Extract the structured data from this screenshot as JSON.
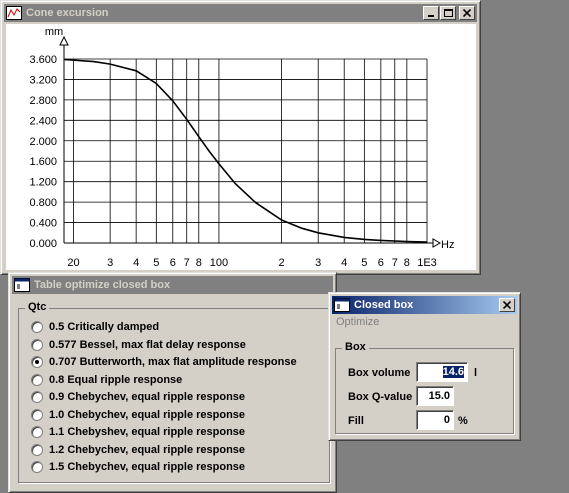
{
  "cone_window": {
    "title": "Cone excursion",
    "chart": {
      "y_unit": "mm",
      "x_unit": "Hz"
    }
  },
  "chart_data": {
    "type": "line",
    "title": "Cone excursion",
    "ylabel": "mm",
    "xlabel": "Hz",
    "x_scale": "log",
    "xlim": [
      18,
      1000
    ],
    "ylim": [
      0,
      3.6
    ],
    "grid": true,
    "y_ticks": [
      "3.600",
      "3.200",
      "2.800",
      "2.400",
      "2.000",
      "1.600",
      "1.200",
      "0.800",
      "0.400",
      "0.000"
    ],
    "x_ticks": [
      "20",
      "3",
      "4",
      "5",
      "6",
      "7",
      "8",
      "100",
      "2",
      "3",
      "4",
      "5",
      "6",
      "7",
      "8",
      "1E3"
    ],
    "x": [
      18,
      25,
      30,
      40,
      50,
      60,
      70,
      80,
      90,
      100,
      120,
      150,
      200,
      250,
      300,
      400,
      500,
      600,
      800,
      1000
    ],
    "y": [
      3.59,
      3.55,
      3.5,
      3.37,
      3.12,
      2.78,
      2.42,
      2.08,
      1.79,
      1.55,
      1.16,
      0.79,
      0.45,
      0.29,
      0.2,
      0.11,
      0.07,
      0.05,
      0.03,
      0.02
    ]
  },
  "table_window": {
    "title": "Table optimize closed box",
    "group_label": "Qtc",
    "options": [
      {
        "label": "0.5 Critically damped",
        "selected": false
      },
      {
        "label": "0.577 Bessel, max flat delay response",
        "selected": false
      },
      {
        "label": "0.707 Butterworth, max flat amplitude response",
        "selected": true
      },
      {
        "label": "0.8 Equal ripple response",
        "selected": false
      },
      {
        "label": "0.9 Chebychev, equal ripple response",
        "selected": false
      },
      {
        "label": "1.0 Chebychev, equal ripple response",
        "selected": false
      },
      {
        "label": "1.1 Chebyshev, equal ripple response",
        "selected": false
      },
      {
        "label": "1.2 Chebychev, equal ripple response",
        "selected": false
      },
      {
        "label": "1.5 Chebychev, equal ripple response",
        "selected": false
      }
    ]
  },
  "closed_box_window": {
    "title": "Closed box",
    "menu_optimize": "Optimize",
    "group_label": "Box",
    "box_volume_label": "Box volume",
    "box_volume_value": "14.6",
    "box_volume_unit": "l",
    "box_q_label": "Box Q-value",
    "box_q_value": "15.0",
    "fill_label": "Fill",
    "fill_value": "0",
    "fill_unit": "%"
  },
  "colors": {
    "active_title_start": "#0a246a",
    "active_title_end": "#a6caf0",
    "inactive_title": "#808080",
    "face": "#d4d0c8",
    "desktop": "#808080"
  }
}
